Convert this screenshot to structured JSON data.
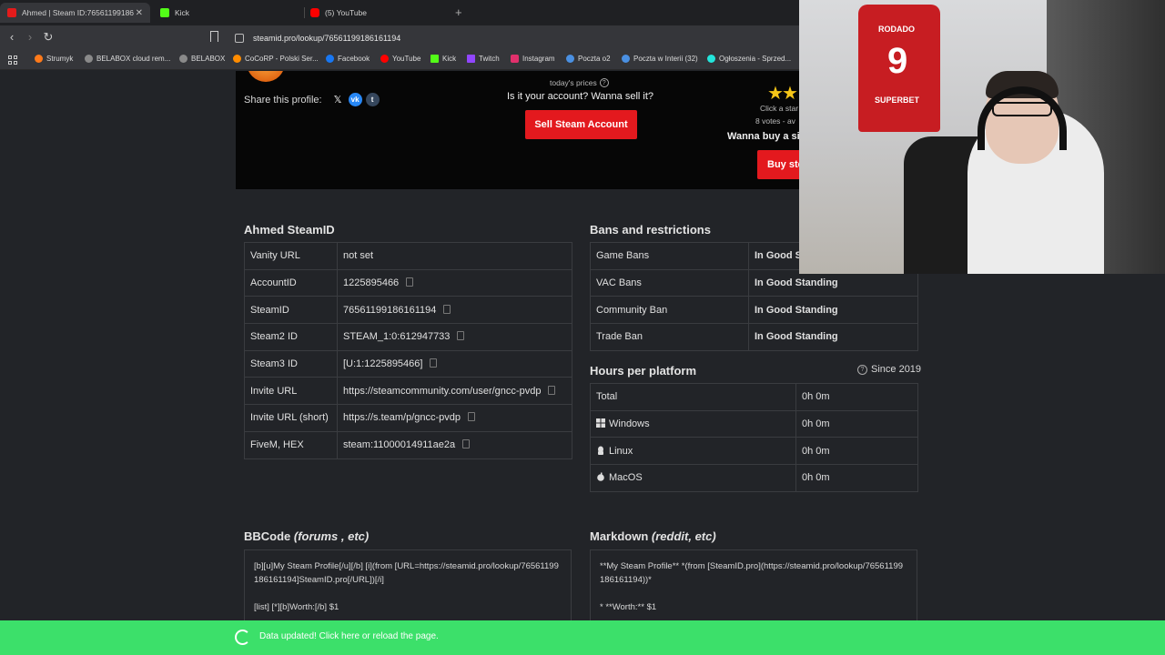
{
  "tabs": [
    {
      "title": "Ahmed | Steam ID:76561199186",
      "color": "#e31b1b",
      "active": true
    },
    {
      "title": "Kick",
      "color": "#53fc18",
      "active": false
    },
    {
      "title": "(5) YouTube",
      "color": "#ff0000",
      "active": false
    }
  ],
  "url": "steamid.pro/lookup/76561199186161194",
  "bookmarks": [
    {
      "label": "Strumyk",
      "color": "#ff7a1a"
    },
    {
      "label": "BELABOX cloud rem...",
      "color": "#8a8a8a"
    },
    {
      "label": "BELABOX",
      "color": "#8a8a8a"
    },
    {
      "label": "CoCoRP - Polski Ser...",
      "color": "#ff8c00"
    },
    {
      "label": "Facebook",
      "color": "#1877f2"
    },
    {
      "label": "YouTube",
      "color": "#ff0000"
    },
    {
      "label": "Kick",
      "color": "#53fc18"
    },
    {
      "label": "Twitch",
      "color": "#9146ff"
    },
    {
      "label": "Instagram",
      "color": "#e1306c"
    },
    {
      "label": "Poczta o2",
      "color": "#4a90e2"
    },
    {
      "label": "Poczta w Interii (32)",
      "color": "#4a90e2"
    },
    {
      "label": "Ogłoszenia - Sprzed...",
      "color": "#23e5db"
    }
  ],
  "hero": {
    "share_label": "Share this profile:",
    "prices_label": "today's prices",
    "question": "Is it your account? Wanna sell it?",
    "sell_button": "Sell Steam Account",
    "click_star": "Click a star",
    "votes": "8 votes - av",
    "wanna_buy": "Wanna buy a si",
    "buy_button": "Buy ste"
  },
  "ids": {
    "title": "Ahmed SteamID",
    "rows": [
      {
        "label": "Vanity URL",
        "value": "not set",
        "copy": false
      },
      {
        "label": "AccountID",
        "value": "1225895466",
        "copy": true
      },
      {
        "label": "SteamID",
        "value": "76561199186161194",
        "copy": true
      },
      {
        "label": "Steam2 ID",
        "value": "STEAM_1:0:612947733",
        "copy": true
      },
      {
        "label": "Steam3 ID",
        "value": "[U:1:1225895466]",
        "copy": true
      },
      {
        "label": "Invite URL",
        "value": "https://steamcommunity.com/user/gncc-pvdp",
        "copy": true
      },
      {
        "label": "Invite URL (short)",
        "value": "https://s.team/p/gncc-pvdp",
        "copy": true
      },
      {
        "label": "FiveM, HEX",
        "value": "steam:11000014911ae2a",
        "copy": true
      }
    ]
  },
  "bans": {
    "title": "Bans and restrictions",
    "rows": [
      {
        "label": "Game Bans",
        "value": "In Good St"
      },
      {
        "label": "VAC Bans",
        "value": "In Good Standing"
      },
      {
        "label": "Community Ban",
        "value": "In Good Standing"
      },
      {
        "label": "Trade Ban",
        "value": "In Good Standing"
      }
    ]
  },
  "hours": {
    "title": "Hours per platform",
    "since": "Since 2019",
    "rows": [
      {
        "label": "Total",
        "value": "0h 0m",
        "icon": ""
      },
      {
        "label": "Windows",
        "value": "0h 0m",
        "icon": "windows-icon"
      },
      {
        "label": "Linux",
        "value": "0h 0m",
        "icon": "linux-icon"
      },
      {
        "label": "MacOS",
        "value": "0h 0m",
        "icon": "apple-icon"
      }
    ]
  },
  "bbcode": {
    "title": "BBCode",
    "title_suffix": " (forums , etc)",
    "line1": "[b][u]My Steam Profile[/u][/b] [i](from [URL=https://steamid.pro/lookup/76561199186161194]SteamID.pro[/URL])[/i]",
    "line2": "[list] [*][b]Worth:[/b] $1"
  },
  "markdown": {
    "title": "Markdown",
    "title_suffix": " (reddit, etc)",
    "line1": "**My Steam Profile** *(from [SteamID.pro](https://steamid.pro/lookup/76561199186161194))*",
    "line2": "* **Worth:** $1"
  },
  "toast": "Data updated! Click here or reload the page.",
  "webcam": {
    "jersey_name": "RODADO",
    "jersey_number": "9",
    "jersey_sponsor": "SUPERBET"
  }
}
